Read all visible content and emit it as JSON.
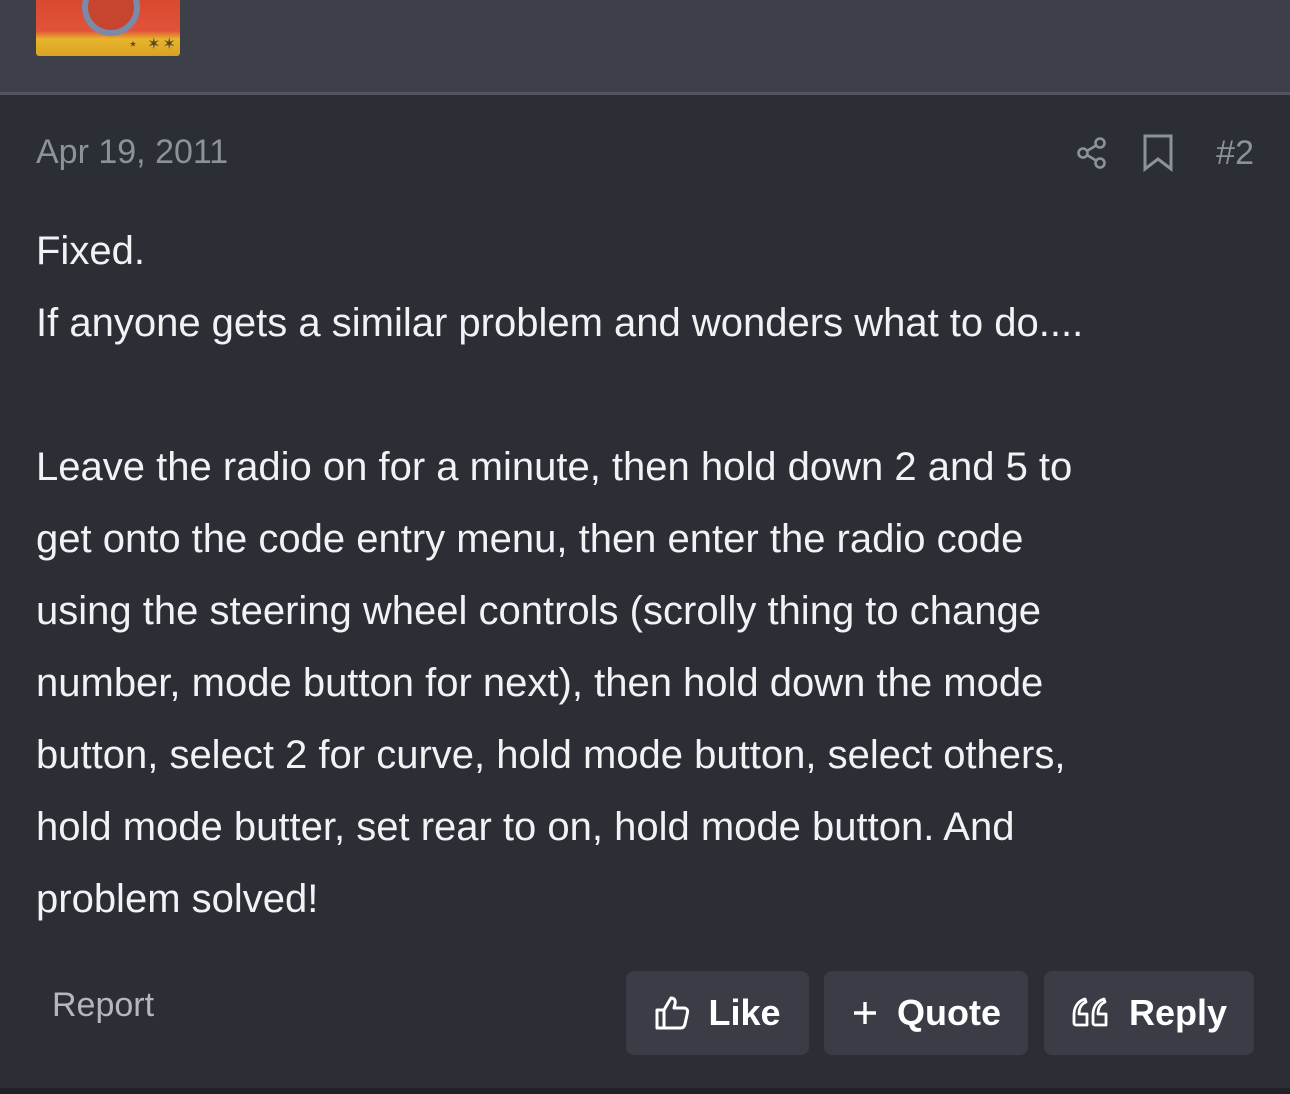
{
  "post": {
    "date": "Apr 19, 2011",
    "number": "#2",
    "body": {
      "line1": "Fixed.",
      "line2": "If anyone gets a similar problem and wonders what to do....",
      "para2": [
        "Leave the radio on for a minute, then hold down 2 and 5 to",
        "get onto the code entry menu, then enter the radio code",
        "using the steering wheel controls (scrolly thing to change",
        "number, mode button for next), then hold down the mode",
        "button, select 2 for curve, hold mode button, select others,",
        "hold mode butter, set rear to on, hold mode button. And",
        "problem solved!"
      ]
    }
  },
  "actions": {
    "report_label": "Report",
    "like_label": "Like",
    "quote_label": "Quote",
    "reply_label": "Reply"
  },
  "icons": {
    "share": "share-icon",
    "bookmark": "bookmark-icon",
    "like": "thumbs-up-icon",
    "quote": "plus-icon",
    "reply": "quote-marks-icon"
  },
  "colors": {
    "background": "#2c2e35",
    "user_strip": "#3e4049",
    "muted_text": "#8d919a",
    "body_text": "#f1f2f4",
    "button_bg": "#3a3d45"
  }
}
